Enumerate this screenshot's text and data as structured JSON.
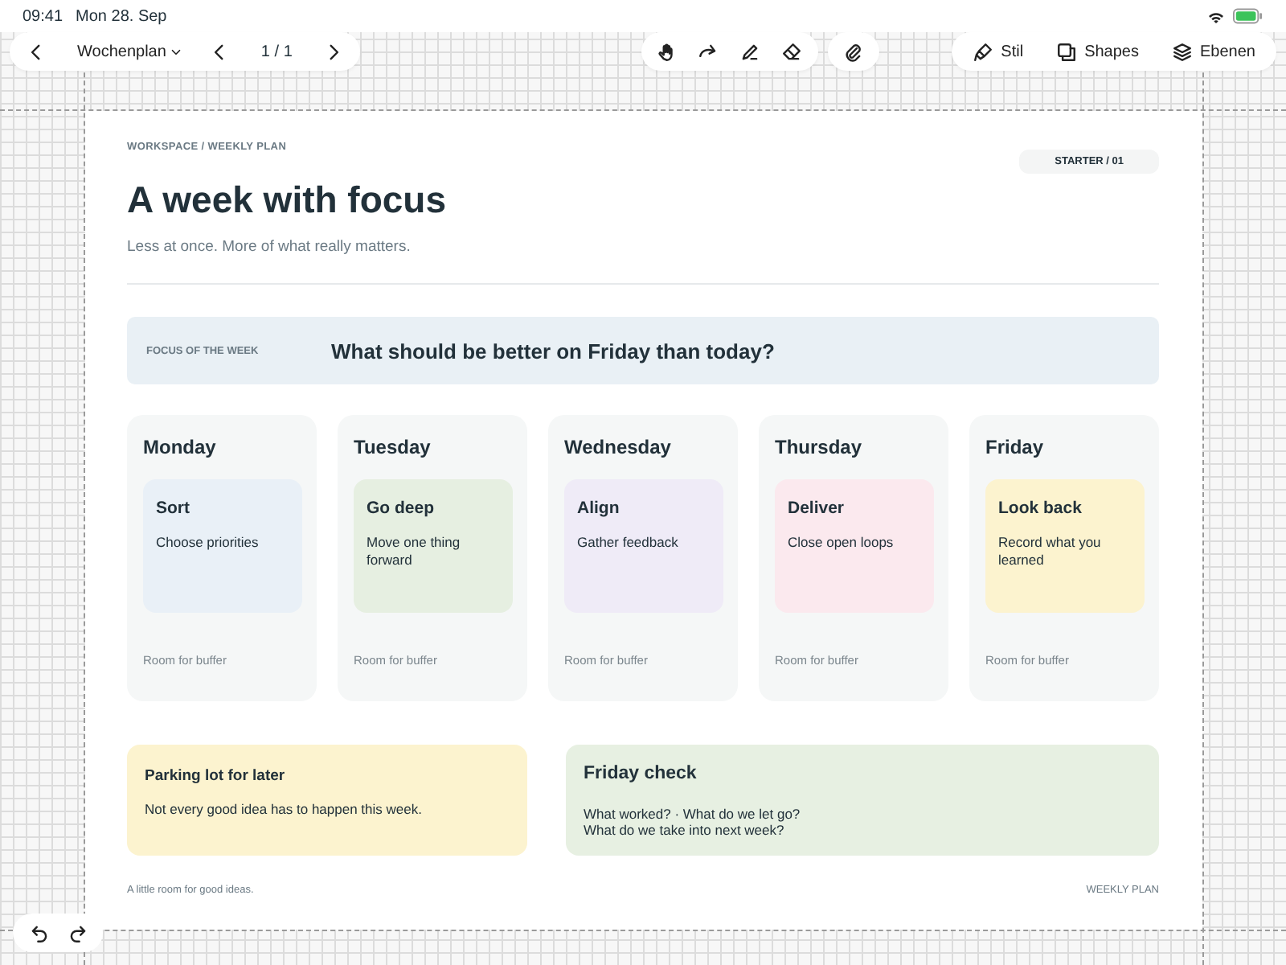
{
  "status_bar": {
    "time": "09:41",
    "date": "Mon 28. Sep"
  },
  "toolbar": {
    "document_title": "Wochenplan",
    "page": "1 / 1",
    "buttons": [
      {
        "label": "Stil"
      },
      {
        "label": "Shapes"
      },
      {
        "label": "Ebenen"
      }
    ]
  },
  "page": {
    "breadcrumb": "WORKSPACE  /  WEEKLY PLAN",
    "badge": "STARTER / 01",
    "title": "A week with focus",
    "subtitle": "Less at once. More of what really matters.",
    "focus": {
      "label": "FOCUS OF THE WEEK",
      "question": "What should be better on Friday than today?"
    },
    "days": [
      {
        "day": "Monday",
        "note_title": "Sort",
        "note_text": "Choose priorities",
        "color": "#e9f0f7",
        "buffer": "Room for buffer"
      },
      {
        "day": "Tuesday",
        "note_title": "Go deep",
        "note_text": "Move one thing forward",
        "color": "#e6efe1",
        "buffer": "Room for buffer"
      },
      {
        "day": "Wednesday",
        "note_title": "Align",
        "note_text": "Gather feedback",
        "color": "#efebf7",
        "buffer": "Room for buffer"
      },
      {
        "day": "Thursday",
        "note_title": "Deliver",
        "note_text": "Close open loops",
        "color": "#fbe9ee",
        "buffer": "Room for buffer"
      },
      {
        "day": "Friday",
        "note_title": "Look back",
        "note_text": "Record what you learned",
        "color": "#fcf3cf",
        "buffer": "Room for buffer"
      }
    ],
    "parking": {
      "title": "Parking lot for later",
      "text": "Not every good idea has to happen this week."
    },
    "friday_check": {
      "title": "Friday check",
      "lines": [
        "What worked?  ·  What do we let go?",
        "What do we take into next week?"
      ]
    },
    "footer_left": "A little room for good ideas.",
    "footer_right": "WEEKLY PLAN"
  }
}
